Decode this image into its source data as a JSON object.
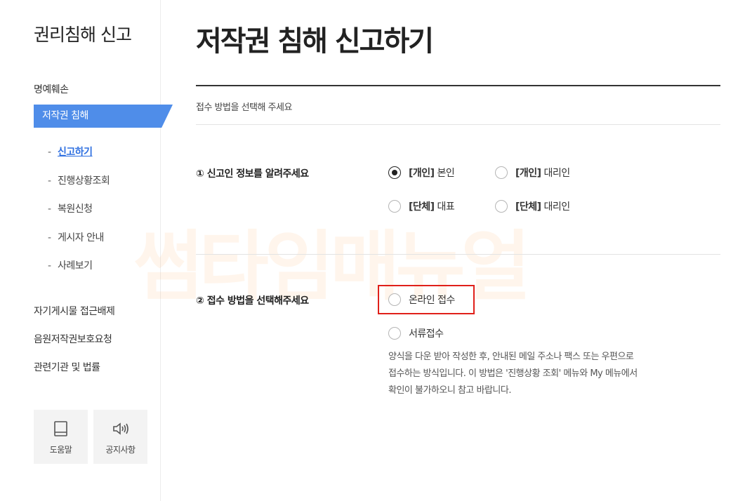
{
  "sidebar": {
    "title": "권리침해 신고",
    "items": [
      {
        "label": "명예훼손"
      },
      {
        "label": "저작권 침해"
      }
    ],
    "sub_items": [
      {
        "label": "신고하기"
      },
      {
        "label": "진행상황조회"
      },
      {
        "label": "복원신청"
      },
      {
        "label": "게시자 안내"
      },
      {
        "label": "사례보기"
      }
    ],
    "sub_dash": "-",
    "extra_items": [
      {
        "label": "자기게시물 접근배제"
      },
      {
        "label": "음원저작권보호요청"
      },
      {
        "label": "관련기관 및 법률"
      }
    ],
    "tiles": [
      {
        "label": "도움말",
        "icon": "book-icon"
      },
      {
        "label": "공지사항",
        "icon": "speaker-icon"
      }
    ]
  },
  "main": {
    "title": "저작권 침해 신고하기",
    "instruction": "접수 방법을 선택해 주세요",
    "q1": {
      "label": "① 신고인 정보를 알려주세요",
      "options": [
        {
          "tag": "[개인]",
          "text": "본인",
          "checked": true
        },
        {
          "tag": "[개인]",
          "text": "대리인",
          "checked": false
        },
        {
          "tag": "[단체]",
          "text": "대표",
          "checked": false
        },
        {
          "tag": "[단체]",
          "text": "대리인",
          "checked": false
        }
      ]
    },
    "q2": {
      "label": "② 접수 방법을 선택해주세요",
      "options": [
        {
          "text": "온라인 접수",
          "checked": false
        },
        {
          "text": "서류접수",
          "checked": false
        }
      ],
      "description": [
        "양식을 다운 받아 작성한 후, 안내된 메일 주소나 팩스 또는 우편으로",
        "접수하는 방식입니다. 이 방법은 '진행상황 조회' 메뉴와 My 메뉴에서",
        "확인이 불가하오니 참고 바랍니다."
      ]
    }
  },
  "watermark": "썸타임매뉴얼",
  "colors": {
    "accent": "#4f8de9",
    "link": "#2e6fe0",
    "highlight": "#e0201a",
    "watermark": "#ff7a00"
  }
}
